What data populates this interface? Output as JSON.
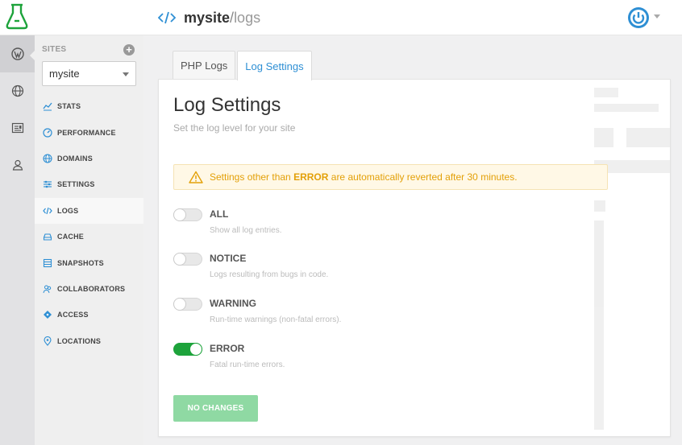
{
  "header": {
    "site_name": "mysite",
    "separator": "/",
    "page_name": "logs",
    "accent": "#2e8fd4"
  },
  "sidebar": {
    "sites_heading": "SITES",
    "add_label": "+",
    "selected_site": "mysite",
    "items": [
      {
        "label": "STATS",
        "icon": "stats-icon"
      },
      {
        "label": "PERFORMANCE",
        "icon": "gauge-icon"
      },
      {
        "label": "DOMAINS",
        "icon": "globe-icon"
      },
      {
        "label": "SETTINGS",
        "icon": "sliders-icon"
      },
      {
        "label": "LOGS",
        "icon": "code-icon",
        "active": true
      },
      {
        "label": "CACHE",
        "icon": "cache-icon"
      },
      {
        "label": "SNAPSHOTS",
        "icon": "snapshot-icon"
      },
      {
        "label": "COLLABORATORS",
        "icon": "people-icon"
      },
      {
        "label": "ACCESS",
        "icon": "key-icon"
      },
      {
        "label": "LOCATIONS",
        "icon": "pin-icon"
      }
    ]
  },
  "tabs": [
    {
      "label": "PHP Logs",
      "active": false
    },
    {
      "label": "Log Settings",
      "active": true
    }
  ],
  "main": {
    "title": "Log Settings",
    "subtitle": "Set the log level for your site",
    "warning": {
      "prefix": "Settings other than ",
      "emphasis": "ERROR",
      "suffix": " are automatically reverted after 30 minutes."
    },
    "options": [
      {
        "label": "ALL",
        "description": "Show all log entries.",
        "enabled": false
      },
      {
        "label": "NOTICE",
        "description": "Logs resulting from bugs in code.",
        "enabled": false
      },
      {
        "label": "WARNING",
        "description": "Run-time warnings (non-fatal errors).",
        "enabled": false
      },
      {
        "label": "ERROR",
        "description": "Fatal run-time errors.",
        "enabled": true
      }
    ],
    "button_label": "NO CHANGES"
  },
  "colors": {
    "toggle_on": "#1da33b",
    "warning_text": "#e3a008",
    "button_disabled": "#8fd9a3"
  }
}
